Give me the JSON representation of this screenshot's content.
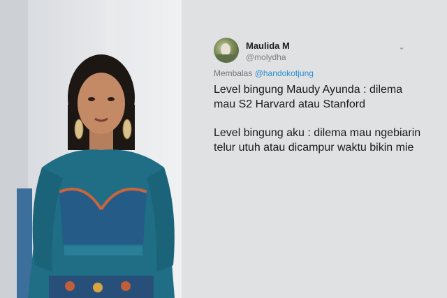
{
  "tweet": {
    "display_name": "Maulida M",
    "handle": "@molydha",
    "reply_prefix": "Membalas ",
    "reply_mention": "@handokotjung",
    "paragraphs": [
      "Level bingung Maudy Ayunda : dilema mau S2 Harvard atau Stanford",
      "Level bingung aku : dilema mau ngebiarin telur utuh atau dicampur waktu bikin mie"
    ]
  },
  "icons": {
    "more": "chevron-down-icon"
  },
  "colors": {
    "mention": "#2a8fcf",
    "text": "#1a1a1a",
    "muted": "#7a7f85"
  }
}
